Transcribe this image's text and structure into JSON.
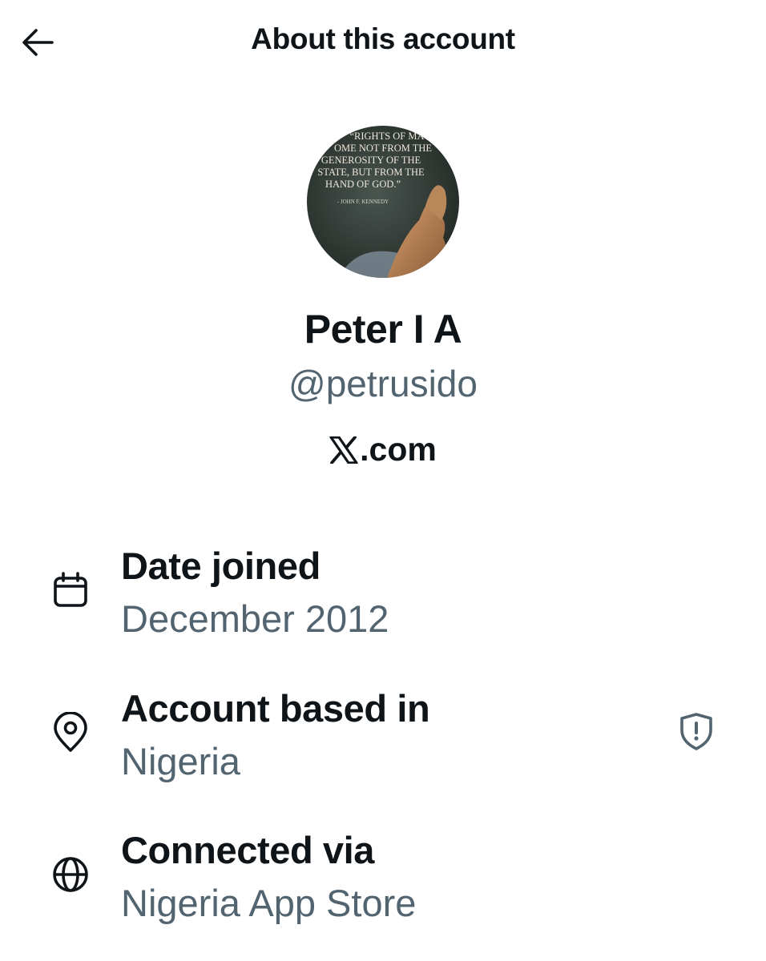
{
  "header": {
    "title": "About this account"
  },
  "profile": {
    "avatar_quote": [
      "“RIGHTS OF MA",
      "OME NOT FROM THE",
      "GENEROSITY OF THE",
      "STATE, BUT FROM THE",
      "HAND OF GOD.”"
    ],
    "avatar_attribution": "- JOHN F. KENNEDY",
    "display_name": "Peter I A",
    "handle": "@petrusido",
    "site": ".com"
  },
  "details": {
    "date_joined": {
      "icon": "calendar-icon",
      "label": "Date joined",
      "value": "December 2012"
    },
    "based_in": {
      "icon": "location-pin-icon",
      "label": "Account based in",
      "value": "Nigeria",
      "action_icon": "shield-alert-icon"
    },
    "connected_via": {
      "icon": "globe-icon",
      "label": "Connected via",
      "value": "Nigeria App Store"
    }
  },
  "colors": {
    "primary_text": "#0f1419",
    "secondary_text": "#536471",
    "background": "#ffffff"
  }
}
